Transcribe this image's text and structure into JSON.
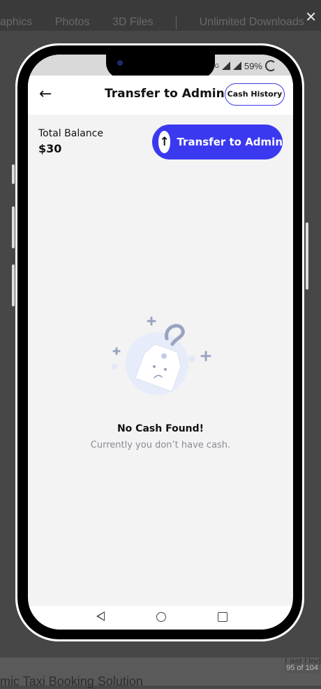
{
  "page": {
    "tabs": [
      "aphics",
      "Photos",
      "3D Files",
      "Unlimited Downloads"
    ],
    "close_glyph": "✕",
    "footer_title": "amic Taxi Booking Solution",
    "footer_counter": "95 of 104",
    "footer_last": "Last Upd"
  },
  "status_bar": {
    "network": "4G",
    "battery": "59%"
  },
  "app_bar": {
    "back_glyph": "←",
    "title": "Transfer to Admin",
    "cash_history_label": "Cash History"
  },
  "balance": {
    "label": "Total Balance",
    "value": "$30"
  },
  "transfer_button": {
    "label": "Transfer to Admin",
    "arrow_glyph": "↑"
  },
  "empty_state": {
    "title": "No Cash Found!",
    "subtitle": "Currently you don’t have cash."
  },
  "colors": {
    "accent": "#3b39f0",
    "screen_bg": "#f3f3f3",
    "muted_text": "#8a8a95"
  }
}
